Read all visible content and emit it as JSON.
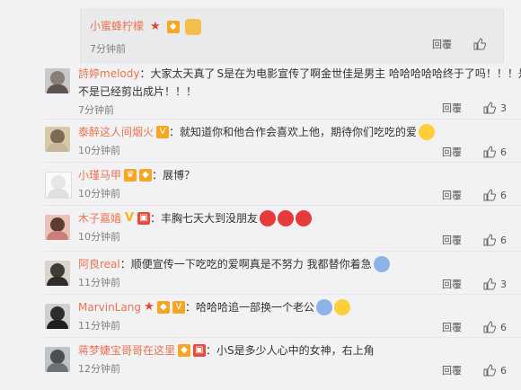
{
  "nested": {
    "username": "小蜜蜂柠檬",
    "time": "7分钟前",
    "reply_label": "回覆",
    "like_count": "",
    "emoji": "cat-face-emoji"
  },
  "comments": [
    {
      "username": "詩婷melody",
      "text_line1": "：大家太天真了",
      "text_after_emoji": "S是在为电影宣传了啊金世佳是男主 哈哈哈哈哈终于了吗！！！是",
      "text_line2": "不是已经剪出成片！！！",
      "time": "7分钟前",
      "reply_label": "回覆",
      "like_count": "3"
    },
    {
      "username": "泰醉这人间烟火",
      "text_line1": "：就知道你和他合作会喜欢上他，期待你们吃吃的爱",
      "time": "10分钟前",
      "reply_label": "回覆",
      "like_count": "6"
    },
    {
      "username": "小瑾马甲",
      "text_line1": "：展博？",
      "time": "10分钟前",
      "reply_label": "回覆",
      "like_count": "6"
    },
    {
      "username": "木子嘉嫱",
      "text_line1": "：丰胸七天大到没朋友",
      "time": "10分钟前",
      "reply_label": "回覆",
      "like_count": "6"
    },
    {
      "username": "阿良real",
      "text_line1": "：顺便宣传一下吃吃的爱啊真是不努力 我都替你着急",
      "time": "11分钟前",
      "reply_label": "回覆",
      "like_count": "3"
    },
    {
      "username": "MarvinLang",
      "text_line1": "：哈哈哈追一部换一个老公",
      "time": "11分钟前",
      "reply_label": "回覆",
      "like_count": "6"
    },
    {
      "username": "蒋梦婕宝哥哥在这里",
      "text_line1": "：小S是多少人心中的女神，右上角",
      "time": "12分钟前",
      "reply_label": "回覆",
      "like_count": "6"
    }
  ],
  "colors": {
    "username": "#eb7350",
    "time": "#808080",
    "text": "#333333",
    "background": "#f2f2f5"
  }
}
